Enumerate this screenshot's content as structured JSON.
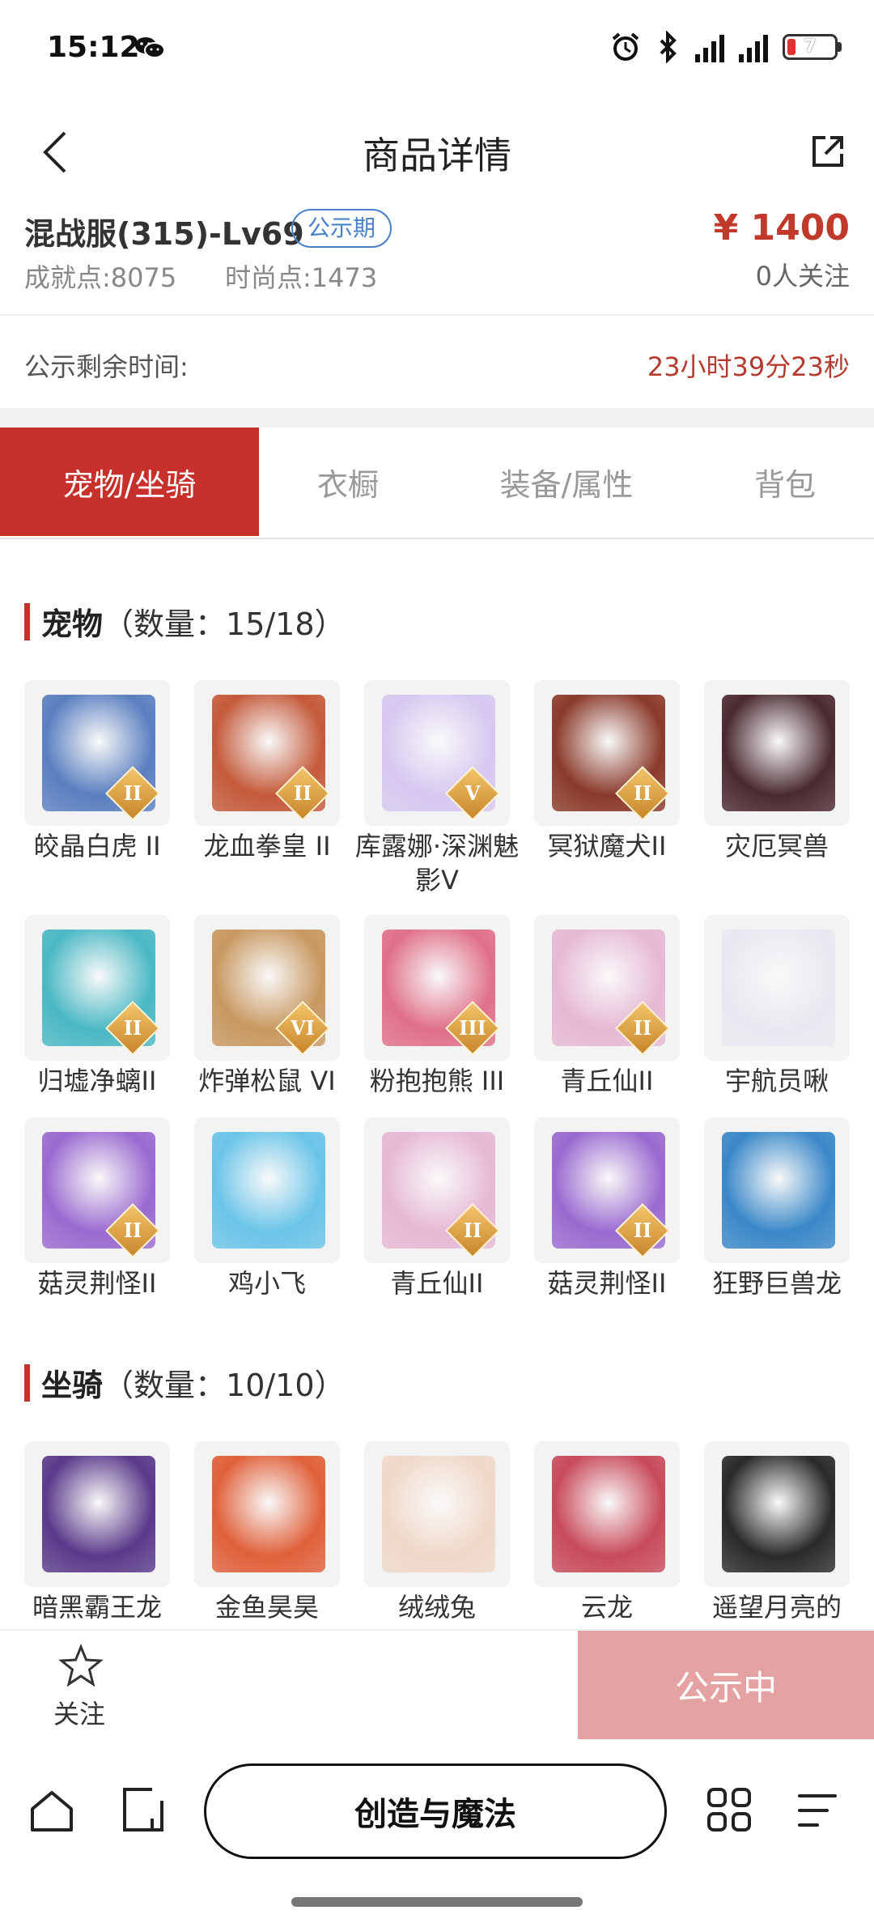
{
  "status_bar": {
    "time": "15:12",
    "battery": "7",
    "net1": "5G",
    "net2": "5G"
  },
  "header": {
    "title": "商品详情"
  },
  "product": {
    "name": "混战服(315)-Lv69",
    "badge": "公示期",
    "price": "¥ 1400",
    "achievement": "成就点:8075",
    "fashion": "时尚点:1473",
    "followers": "0人关注",
    "remaining_label": "公示剩余时间:",
    "remaining_value": "23小时39分23秒"
  },
  "tabs": [
    {
      "label": "宠物/坐骑",
      "active": true
    },
    {
      "label": "衣橱"
    },
    {
      "label": "装备/属性"
    },
    {
      "label": "背包"
    }
  ],
  "pets": {
    "title": "宠物",
    "count": "（数量：15/18）",
    "items": [
      {
        "name": "皎晶白虎 II",
        "rank": "II",
        "color": "#5a7fc0"
      },
      {
        "name": "龙血拳皇 II",
        "rank": "II",
        "color": "#c45a3a"
      },
      {
        "name": "库露娜·深渊魅影V",
        "rank": "V",
        "color": "#d6c8f0"
      },
      {
        "name": "冥狱魔犬II",
        "rank": "II",
        "color": "#8a3a2a"
      },
      {
        "name": "灾厄冥兽",
        "rank": "",
        "color": "#4a2a30"
      },
      {
        "name": "归墟净螭II",
        "rank": "II",
        "color": "#4ab8c4"
      },
      {
        "name": "炸弹松鼠 VI",
        "rank": "VI",
        "color": "#c89860"
      },
      {
        "name": "粉抱抱熊 III",
        "rank": "III",
        "color": "#e0708a"
      },
      {
        "name": "青丘仙II",
        "rank": "II",
        "color": "#e6b8d4"
      },
      {
        "name": "宇航员啾",
        "rank": "",
        "color": "#e8e8f0"
      },
      {
        "name": "菇灵荆怪II",
        "rank": "II",
        "color": "#9a6ad0"
      },
      {
        "name": "鸡小飞",
        "rank": "",
        "color": "#6ac4e8"
      },
      {
        "name": "青丘仙II",
        "rank": "II",
        "color": "#e6b8d4"
      },
      {
        "name": "菇灵荆怪II",
        "rank": "II",
        "color": "#9a6ad0"
      },
      {
        "name": "狂野巨兽龙",
        "rank": "",
        "color": "#3a88c8"
      }
    ]
  },
  "mounts": {
    "title": "坐骑",
    "count": "（数量：10/10）",
    "items": [
      {
        "name": "暗黑霸王龙",
        "color": "#5a3a8a"
      },
      {
        "name": "金鱼昊昊",
        "color": "#e0603a"
      },
      {
        "name": "绒绒兔",
        "color": "#f0d8c8"
      },
      {
        "name": "云龙",
        "color": "#c84a5a"
      },
      {
        "name": "遥望月亮的",
        "color": "#2a2a2a"
      }
    ]
  },
  "action_bar": {
    "follow_label": "关注",
    "public_button": "公示中"
  },
  "nav": {
    "center_label": "创造与魔法"
  }
}
